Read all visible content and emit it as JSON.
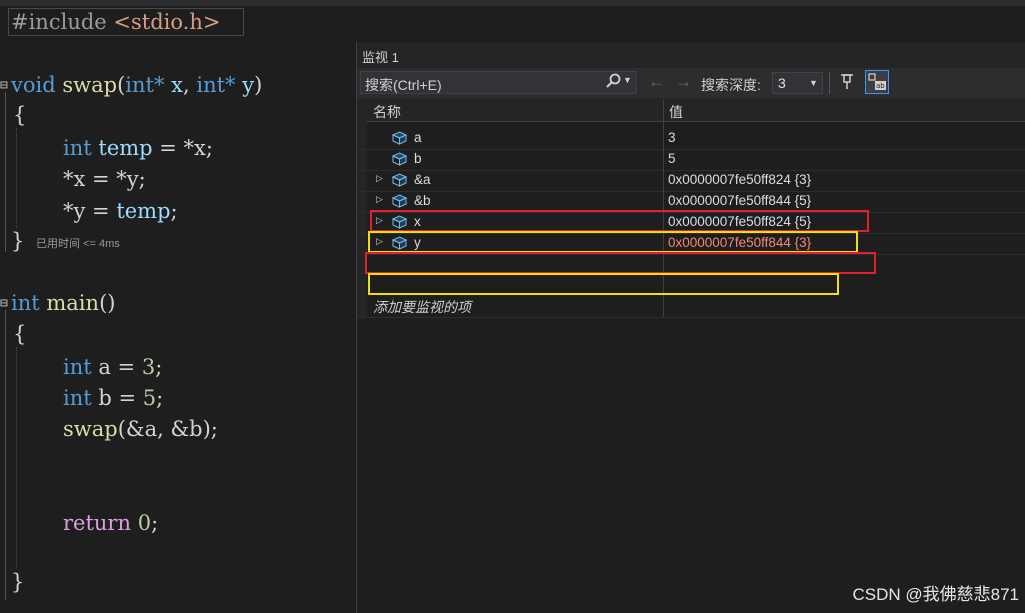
{
  "editor": {
    "include_directive": "#include",
    "include_header": "<stdio.h>",
    "swap_signature": {
      "ret": "void",
      "name": "swap",
      "open": "(",
      "t1": "int*",
      "p1": "x",
      "comma": ",",
      "t2": "int*",
      "p2": "y",
      "close": ")"
    },
    "open_brace": "{",
    "close_brace": "}",
    "line_temp": {
      "type": "int",
      "var": "temp",
      "rest": " = *x;"
    },
    "line_x": "*x = *y;",
    "line_y": {
      "lhs": "*y = ",
      "rhs": "temp",
      "end": ";"
    },
    "elapsed_hint": "已用时间 <= 4ms",
    "main_signature": {
      "ret": "int",
      "name": "main",
      "parens": "()"
    },
    "line_a": {
      "type": "int",
      "rest_pre": " a = ",
      "num": "3",
      "end": ";"
    },
    "line_b": {
      "type": "int",
      "rest_pre": " b = ",
      "num": "5",
      "end": ";"
    },
    "line_call": {
      "fn": "swap",
      "rest": "(&a, &b);"
    },
    "line_return": {
      "kw": "return",
      "num": "0",
      "end": ";"
    }
  },
  "watch": {
    "title": "监视 1",
    "search_placeholder": "搜索(Ctrl+E)",
    "depth_label": "搜索深度:",
    "depth_value": "3",
    "columns": {
      "name": "名称",
      "value": "值"
    },
    "rows": [
      {
        "name": "a",
        "value": "3",
        "expandable": false,
        "changed": false
      },
      {
        "name": "b",
        "value": "5",
        "expandable": false,
        "changed": false
      },
      {
        "name": "&a",
        "value": "0x0000007fe50ff824 {3}",
        "expandable": true,
        "changed": false
      },
      {
        "name": "&b",
        "value": "0x0000007fe50ff844 {5}",
        "expandable": true,
        "changed": false
      },
      {
        "name": "x",
        "value": "0x0000007fe50ff824 {5}",
        "expandable": true,
        "changed": false
      },
      {
        "name": "y",
        "value": "0x0000007fe50ff844 {3}",
        "expandable": true,
        "changed": true
      }
    ],
    "add_item_text": "添加要监视的项"
  },
  "watermark": "CSDN @我佛慈悲871",
  "colors": {
    "keyword": "#569cd6",
    "function": "#dcdcaa",
    "changed_value": "#f48771",
    "highlight_red": "#e0202a",
    "highlight_yellow": "#f0e010"
  }
}
